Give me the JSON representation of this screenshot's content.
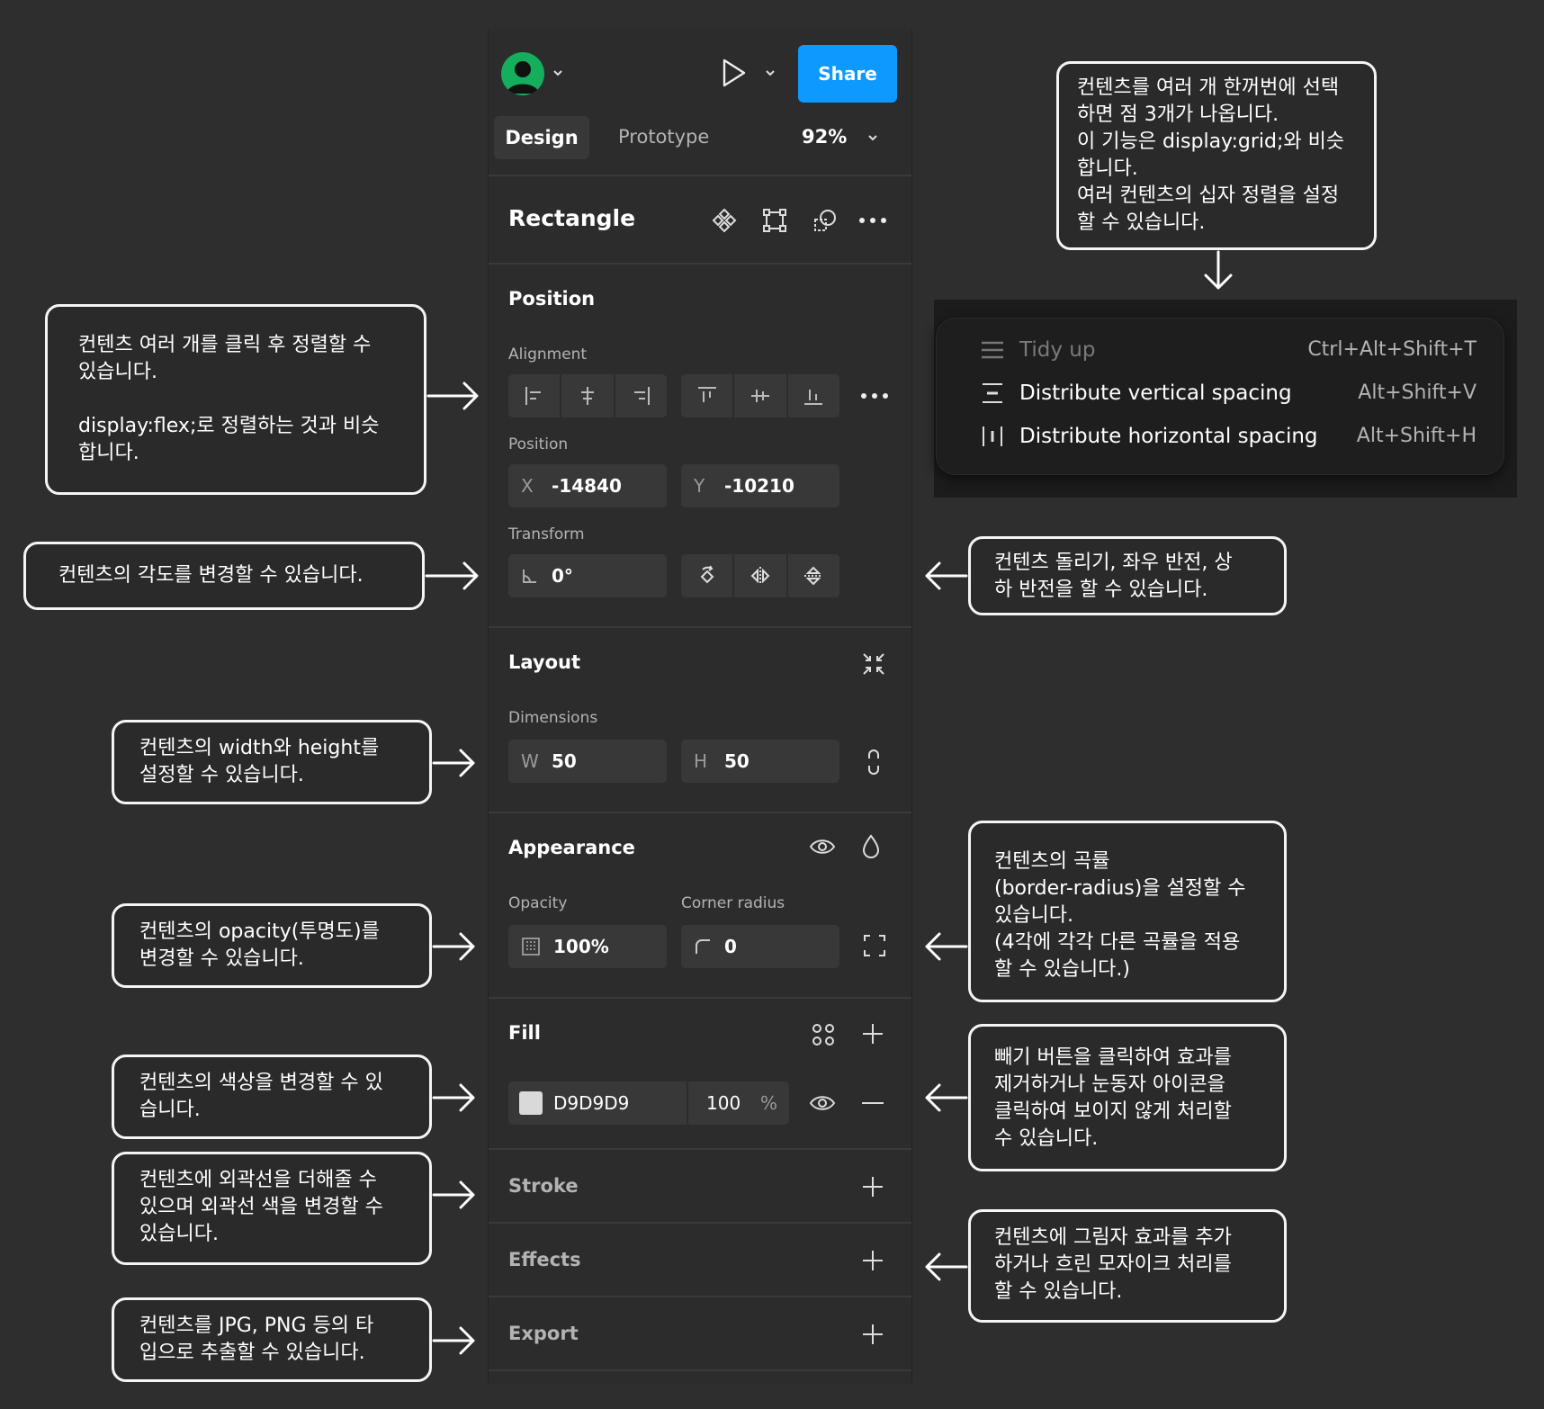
{
  "toolbar": {
    "share_label": "Share"
  },
  "tabs": {
    "design": "Design",
    "prototype": "Prototype",
    "zoom": "92%"
  },
  "layer": {
    "title": "Rectangle"
  },
  "position": {
    "title": "Position",
    "alignment_label": "Alignment",
    "position_label": "Position",
    "x_label": "X",
    "x_value": "-14840",
    "y_label": "Y",
    "y_value": "-10210",
    "transform_label": "Transform",
    "rotation_value": "0°"
  },
  "layout": {
    "title": "Layout",
    "dimensions_label": "Dimensions",
    "w_label": "W",
    "w_value": "50",
    "h_label": "H",
    "h_value": "50"
  },
  "appearance": {
    "title": "Appearance",
    "opacity_label": "Opacity",
    "opacity_value": "100%",
    "radius_label": "Corner radius",
    "radius_value": "0"
  },
  "fill": {
    "title": "Fill",
    "hex": "D9D9D9",
    "opacity": "100",
    "percent": "%",
    "swatch_color": "#d9d9d9"
  },
  "stroke": {
    "title": "Stroke"
  },
  "effects": {
    "title": "Effects"
  },
  "export": {
    "title": "Export"
  },
  "menu": {
    "items": [
      {
        "label": "Tidy up",
        "shortcut": "Ctrl+Alt+Shift+T",
        "disabled": true
      },
      {
        "label": "Distribute vertical spacing",
        "shortcut": "Alt+Shift+V"
      },
      {
        "label": "Distribute horizontal spacing",
        "shortcut": "Alt+Shift+H"
      }
    ]
  },
  "callouts": {
    "grid": "컨텐츠를 여러 개 한꺼번에 선택\n하면 점 3개가 나옵니다.\n이 기능은 display:grid;와 비슷\n합니다.\n여러 컨텐츠의 십자 정렬을 설정\n할 수 있습니다.",
    "align": "컨텐츠 여러 개를 클릭 후 정렬할 수\n있습니다.\n\ndisplay:flex;로 정렬하는 것과 비슷\n합니다.",
    "angle": "컨텐츠의 각도를 변경할 수 있습니다.",
    "rotate": "컨텐츠 돌리기, 좌우 반전, 상\n하 반전을 할 수 있습니다.",
    "size": "컨텐츠의 width와 height를\n설정할 수 있습니다.",
    "radius": "컨텐츠의 곡률\n(border-radius)을 설정할 수\n있습니다.\n(4각에 각각 다른 곡률을 적용\n할 수 있습니다.)",
    "opacity": "컨텐츠의 opacity(투명도)를\n변경할 수 있습니다.",
    "color": "컨텐츠의 색상을 변경할 수 있\n습니다.",
    "visibility": "빼기 버튼을 클릭하여 효과를\n제거하거나 눈동자 아이콘을\n클릭하여 보이지 않게 처리할\n수 있습니다.",
    "stroke": "컨텐츠에 외곽선을 더해줄 수\n있으며 외곽선 색을 변경할 수\n있습니다.",
    "effects": "컨텐츠에 그림자 효과를 추가\n하거나 흐린 모자이크 처리를\n할 수 있습니다.",
    "export": "컨텐츠를 JPG, PNG 등의 타\n입으로 추출할 수 있습니다."
  }
}
